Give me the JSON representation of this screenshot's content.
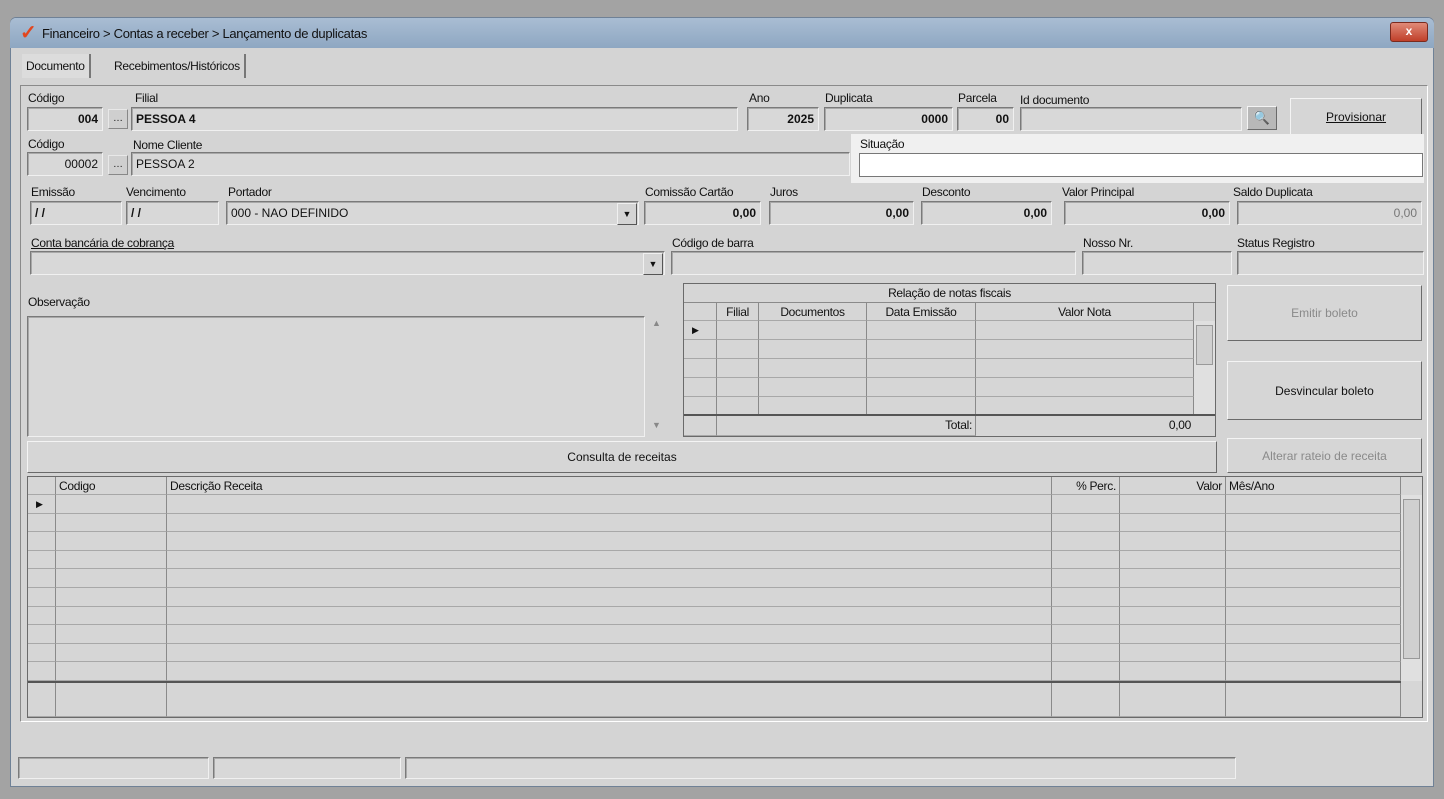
{
  "window": {
    "title": "Financeiro > Contas a receber > Lançamento de duplicatas",
    "close": "x"
  },
  "tabs": [
    {
      "label": "Documento"
    },
    {
      "label": "Recebimentos/Históricos"
    }
  ],
  "filial": {
    "codigo_label": "Código",
    "codigo": "004",
    "filial_label": "Filial",
    "filial": "PESSOA 4"
  },
  "cliente": {
    "codigo_label": "Código",
    "codigo": "00002",
    "nome_label": "Nome Cliente",
    "nome": "PESSOA 2"
  },
  "doc": {
    "ano_label": "Ano",
    "ano": "2025",
    "duplicata_label": "Duplicata",
    "duplicata": "0000",
    "parcela_label": "Parcela",
    "parcela": "00",
    "id_label": "Id documento",
    "id": ""
  },
  "provisionar": "Provisionar",
  "situacao": {
    "label": "Situação",
    "value": ""
  },
  "row3": {
    "emissao_label": "Emissão",
    "emissao": "/ /",
    "vencimento_label": "Vencimento",
    "vencimento": "/ /",
    "portador_label": "Portador",
    "portador": "000 - NAO DEFINIDO",
    "comissao_label": "Comissão Cartão",
    "comissao": "0,00",
    "juros_label": "Juros",
    "juros": "0,00",
    "desconto_label": "Desconto",
    "desconto": "0,00",
    "principal_label": "Valor Principal",
    "principal": "0,00",
    "saldo_label": "Saldo Duplicata",
    "saldo": "0,00"
  },
  "row4": {
    "conta_label": "Conta bancária de cobrança",
    "conta": "",
    "barra_label": "Código de barra",
    "barra": "",
    "nosso_label": "Nosso Nr.",
    "nosso": "",
    "status_label": "Status Registro",
    "status": ""
  },
  "obs": {
    "label": "Observação",
    "value": ""
  },
  "notas": {
    "title": "Relação de notas fiscais",
    "columns": [
      "Filial",
      "Documentos",
      "Data Emissão",
      "Valor Nota"
    ],
    "total_label": "Total:",
    "total": "0,00"
  },
  "buttons": {
    "emitir": "Emitir boleto",
    "desvincular": "Desvincular boleto",
    "alterar": "Alterar rateio de receita",
    "consulta": "Consulta de receitas"
  },
  "receitas": {
    "columns": [
      "Codigo",
      "Descrição Receita",
      "% Perc.",
      "Valor",
      "Mês/Ano"
    ]
  }
}
